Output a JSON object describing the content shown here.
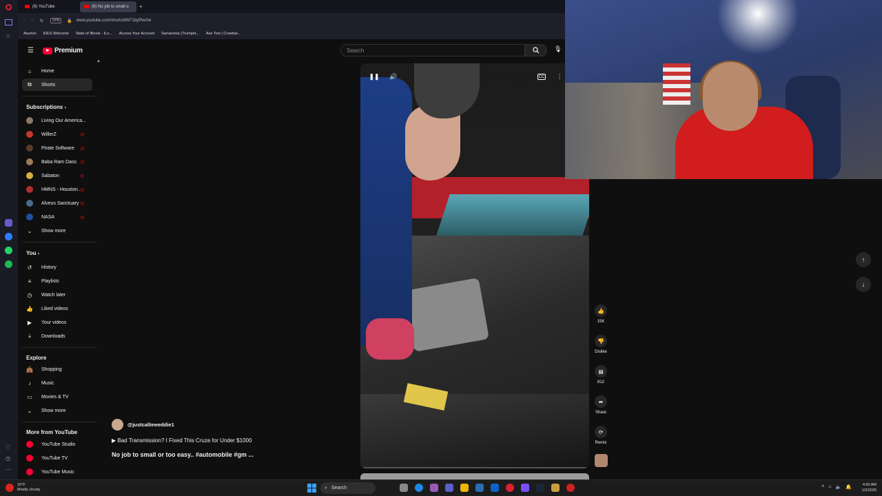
{
  "browser": {
    "tabs": [
      {
        "label": "(6) YouTube",
        "active": false
      },
      {
        "label": "(6) No job to small o",
        "active": true
      }
    ],
    "url": "www.youtube.com/shorts/8W71byPlwXw",
    "vpn_label": "VPN",
    "bookmarks": [
      "Asurion",
      "IDES Welcome",
      "State of Illinois - ILo...",
      "Access Your Account",
      "Sarracenia (Trumpet...",
      "Axe Tool | Crowbar..."
    ]
  },
  "masthead": {
    "brand": "Premium",
    "search_placeholder": "Search"
  },
  "sidebar": {
    "main": [
      {
        "label": "Home",
        "icon": "home-icon"
      },
      {
        "label": "Shorts",
        "icon": "shorts-icon",
        "active": true
      }
    ],
    "subscriptions_heading": "Subscriptions",
    "subscriptions": [
      {
        "label": "Living Our America...",
        "color": "#8a7a6a",
        "live": false
      },
      {
        "label": "WillerZ",
        "color": "#c0392b",
        "live": true
      },
      {
        "label": "Pirate Software",
        "color": "#5a3a2a",
        "live": true
      },
      {
        "label": "Baba Ram Dass",
        "color": "#9a7a5a",
        "live": true
      },
      {
        "label": "Sabaton",
        "color": "#d4b040",
        "live": true
      },
      {
        "label": "HMNS - Houston...",
        "color": "#b03030",
        "live": true
      },
      {
        "label": "Alveus Sanctuary",
        "color": "#4a6a8a",
        "live": true
      },
      {
        "label": "NASA",
        "color": "#1f4fa0",
        "live": true
      }
    ],
    "subs_show_more": "Show more",
    "you_heading": "You",
    "you": [
      {
        "label": "History",
        "icon": "history-icon"
      },
      {
        "label": "Playlists",
        "icon": "playlists-icon"
      },
      {
        "label": "Watch later",
        "icon": "clock-icon"
      },
      {
        "label": "Liked videos",
        "icon": "thumb-up-icon"
      },
      {
        "label": "Your videos",
        "icon": "video-icon"
      },
      {
        "label": "Downloads",
        "icon": "download-icon"
      }
    ],
    "explore_heading": "Explore",
    "explore": [
      {
        "label": "Shopping",
        "icon": "bag-icon"
      },
      {
        "label": "Music",
        "icon": "music-icon"
      },
      {
        "label": "Movies & TV",
        "icon": "film-icon"
      }
    ],
    "explore_show_more": "Show more",
    "more_heading": "More from YouTube",
    "more": [
      {
        "label": "YouTube Studio"
      },
      {
        "label": "YouTube TV"
      },
      {
        "label": "YouTube Music"
      }
    ]
  },
  "short": {
    "channel": "@justcallmeeddie1",
    "playlist": "▶ Bad Transmission? I Fixed This Cruze for Under $1000",
    "title": "No job to small or too easy.. #automobile #gm ...",
    "progress": 0.0
  },
  "actions": {
    "like_count": "15K",
    "dislike_label": "Dislike",
    "comment_count": "812",
    "share_label": "Share",
    "remix_label": "Remix"
  },
  "taskbar": {
    "temp": "16°F",
    "weather": "Mostly cloudy",
    "search_label": "Search",
    "time": "4:00 AM",
    "date": "1/3/2026"
  }
}
